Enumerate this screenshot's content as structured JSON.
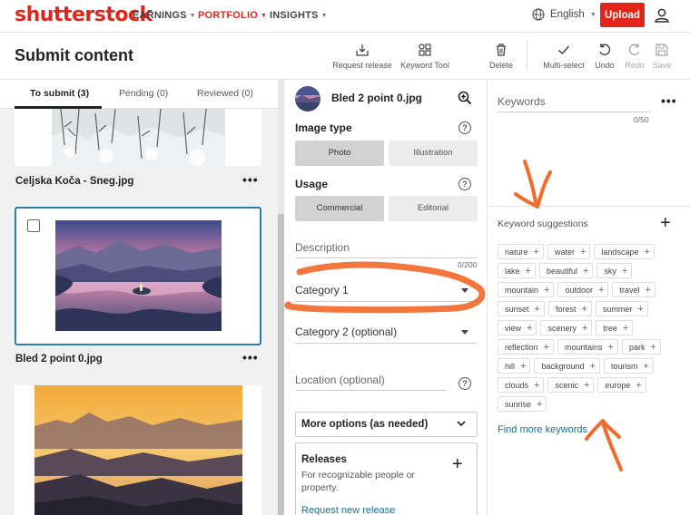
{
  "nav": {
    "logo": "shutterstock",
    "items": [
      {
        "label": "EARNINGS"
      },
      {
        "label": "PORTFOLIO"
      },
      {
        "label": "INSIGHTS"
      }
    ],
    "language": "English",
    "upload_label": "Upload",
    "accent": "#e1251b"
  },
  "header": {
    "title": "Submit content",
    "tools": [
      {
        "label": "Request release",
        "icon": "request-release-icon"
      },
      {
        "label": "Keyword Tool",
        "icon": "keyword-tool-icon"
      },
      {
        "label": "Delete",
        "icon": "trash-icon"
      },
      {
        "label": "Multi-select",
        "icon": "checkmark-icon"
      },
      {
        "label": "Undo",
        "icon": "undo-icon"
      },
      {
        "label": "Redo",
        "icon": "redo-icon"
      },
      {
        "label": "Save",
        "icon": "save-icon"
      }
    ]
  },
  "left": {
    "tabs": [
      {
        "label": "To submit (3)"
      },
      {
        "label": "Pending (0)"
      },
      {
        "label": "Reviewed (0)"
      }
    ],
    "cards": [
      {
        "title": "Celjska Koča - Sneg.jpg"
      },
      {
        "title": "Bled 2 point 0.jpg"
      }
    ]
  },
  "detail": {
    "filename": "Bled 2 point 0.jpg",
    "image_type_label": "Image type",
    "image_type_options": [
      "Photo",
      "Illustration"
    ],
    "usage_label": "Usage",
    "usage_options": [
      "Commercial",
      "Editorial"
    ],
    "description_label": "Description",
    "description_count": "0/200",
    "category1": "Category 1",
    "category2": "Category 2 (optional)",
    "location": "Location (optional)",
    "more_options": "More options (as needed)",
    "releases_title": "Releases",
    "releases_desc": "For recognizable people or property.",
    "request_release": "Request new release"
  },
  "keywords": {
    "label": "Keywords",
    "count": "0/50",
    "suggestions_label": "Keyword suggestions",
    "suggestions": [
      "nature",
      "water",
      "landscape",
      "lake",
      "beautiful",
      "sky",
      "mountain",
      "outdoor",
      "travel",
      "sunset",
      "forest",
      "summer",
      "view",
      "scenery",
      "tree",
      "reflection",
      "mountains",
      "park",
      "hill",
      "background",
      "tourism",
      "clouds",
      "scenic",
      "europe",
      "sunrise"
    ],
    "find_more": "Find more keywords",
    "link_color": "#1a6e8c"
  }
}
